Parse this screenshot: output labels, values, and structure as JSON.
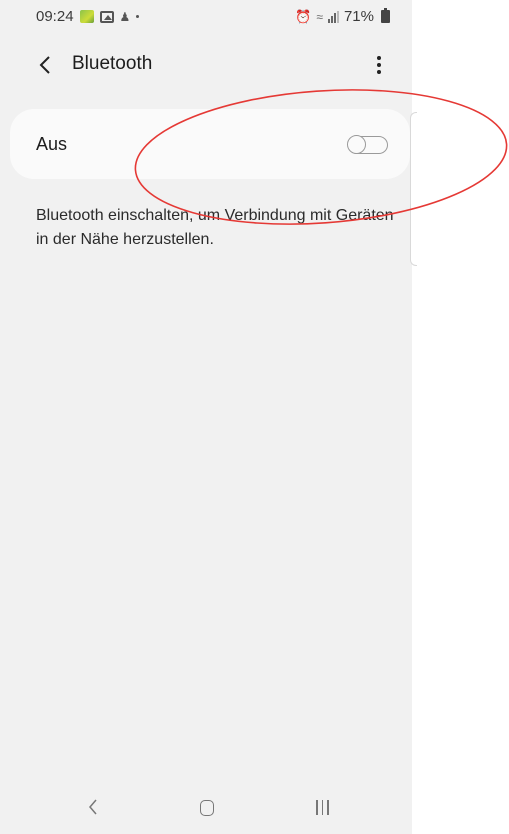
{
  "status_bar": {
    "time": "09:24",
    "battery": "71%",
    "icons_left": [
      "app-notification-icon",
      "gallery-icon",
      "person-icon",
      "dot-icon"
    ],
    "icons_right": [
      "alarm-icon",
      "wifi-icon",
      "signal-icon",
      "battery-icon"
    ]
  },
  "header": {
    "back_icon": "‹",
    "title": "Bluetooth",
    "more_icon": "more-vertical-icon"
  },
  "bluetooth_card": {
    "label": "Aus",
    "toggle_state": "off"
  },
  "description": "Bluetooth einschalten, um Verbindung mit Geräten in der Nähe herzustellen.",
  "navbar": {
    "back_glyph": "‹",
    "home": "home-icon",
    "recent": "recent-apps-icon"
  },
  "colors": {
    "background": "#f1f1f1",
    "card": "#fafafa",
    "annotation": "#e53935",
    "text": "#1d1d1d"
  }
}
